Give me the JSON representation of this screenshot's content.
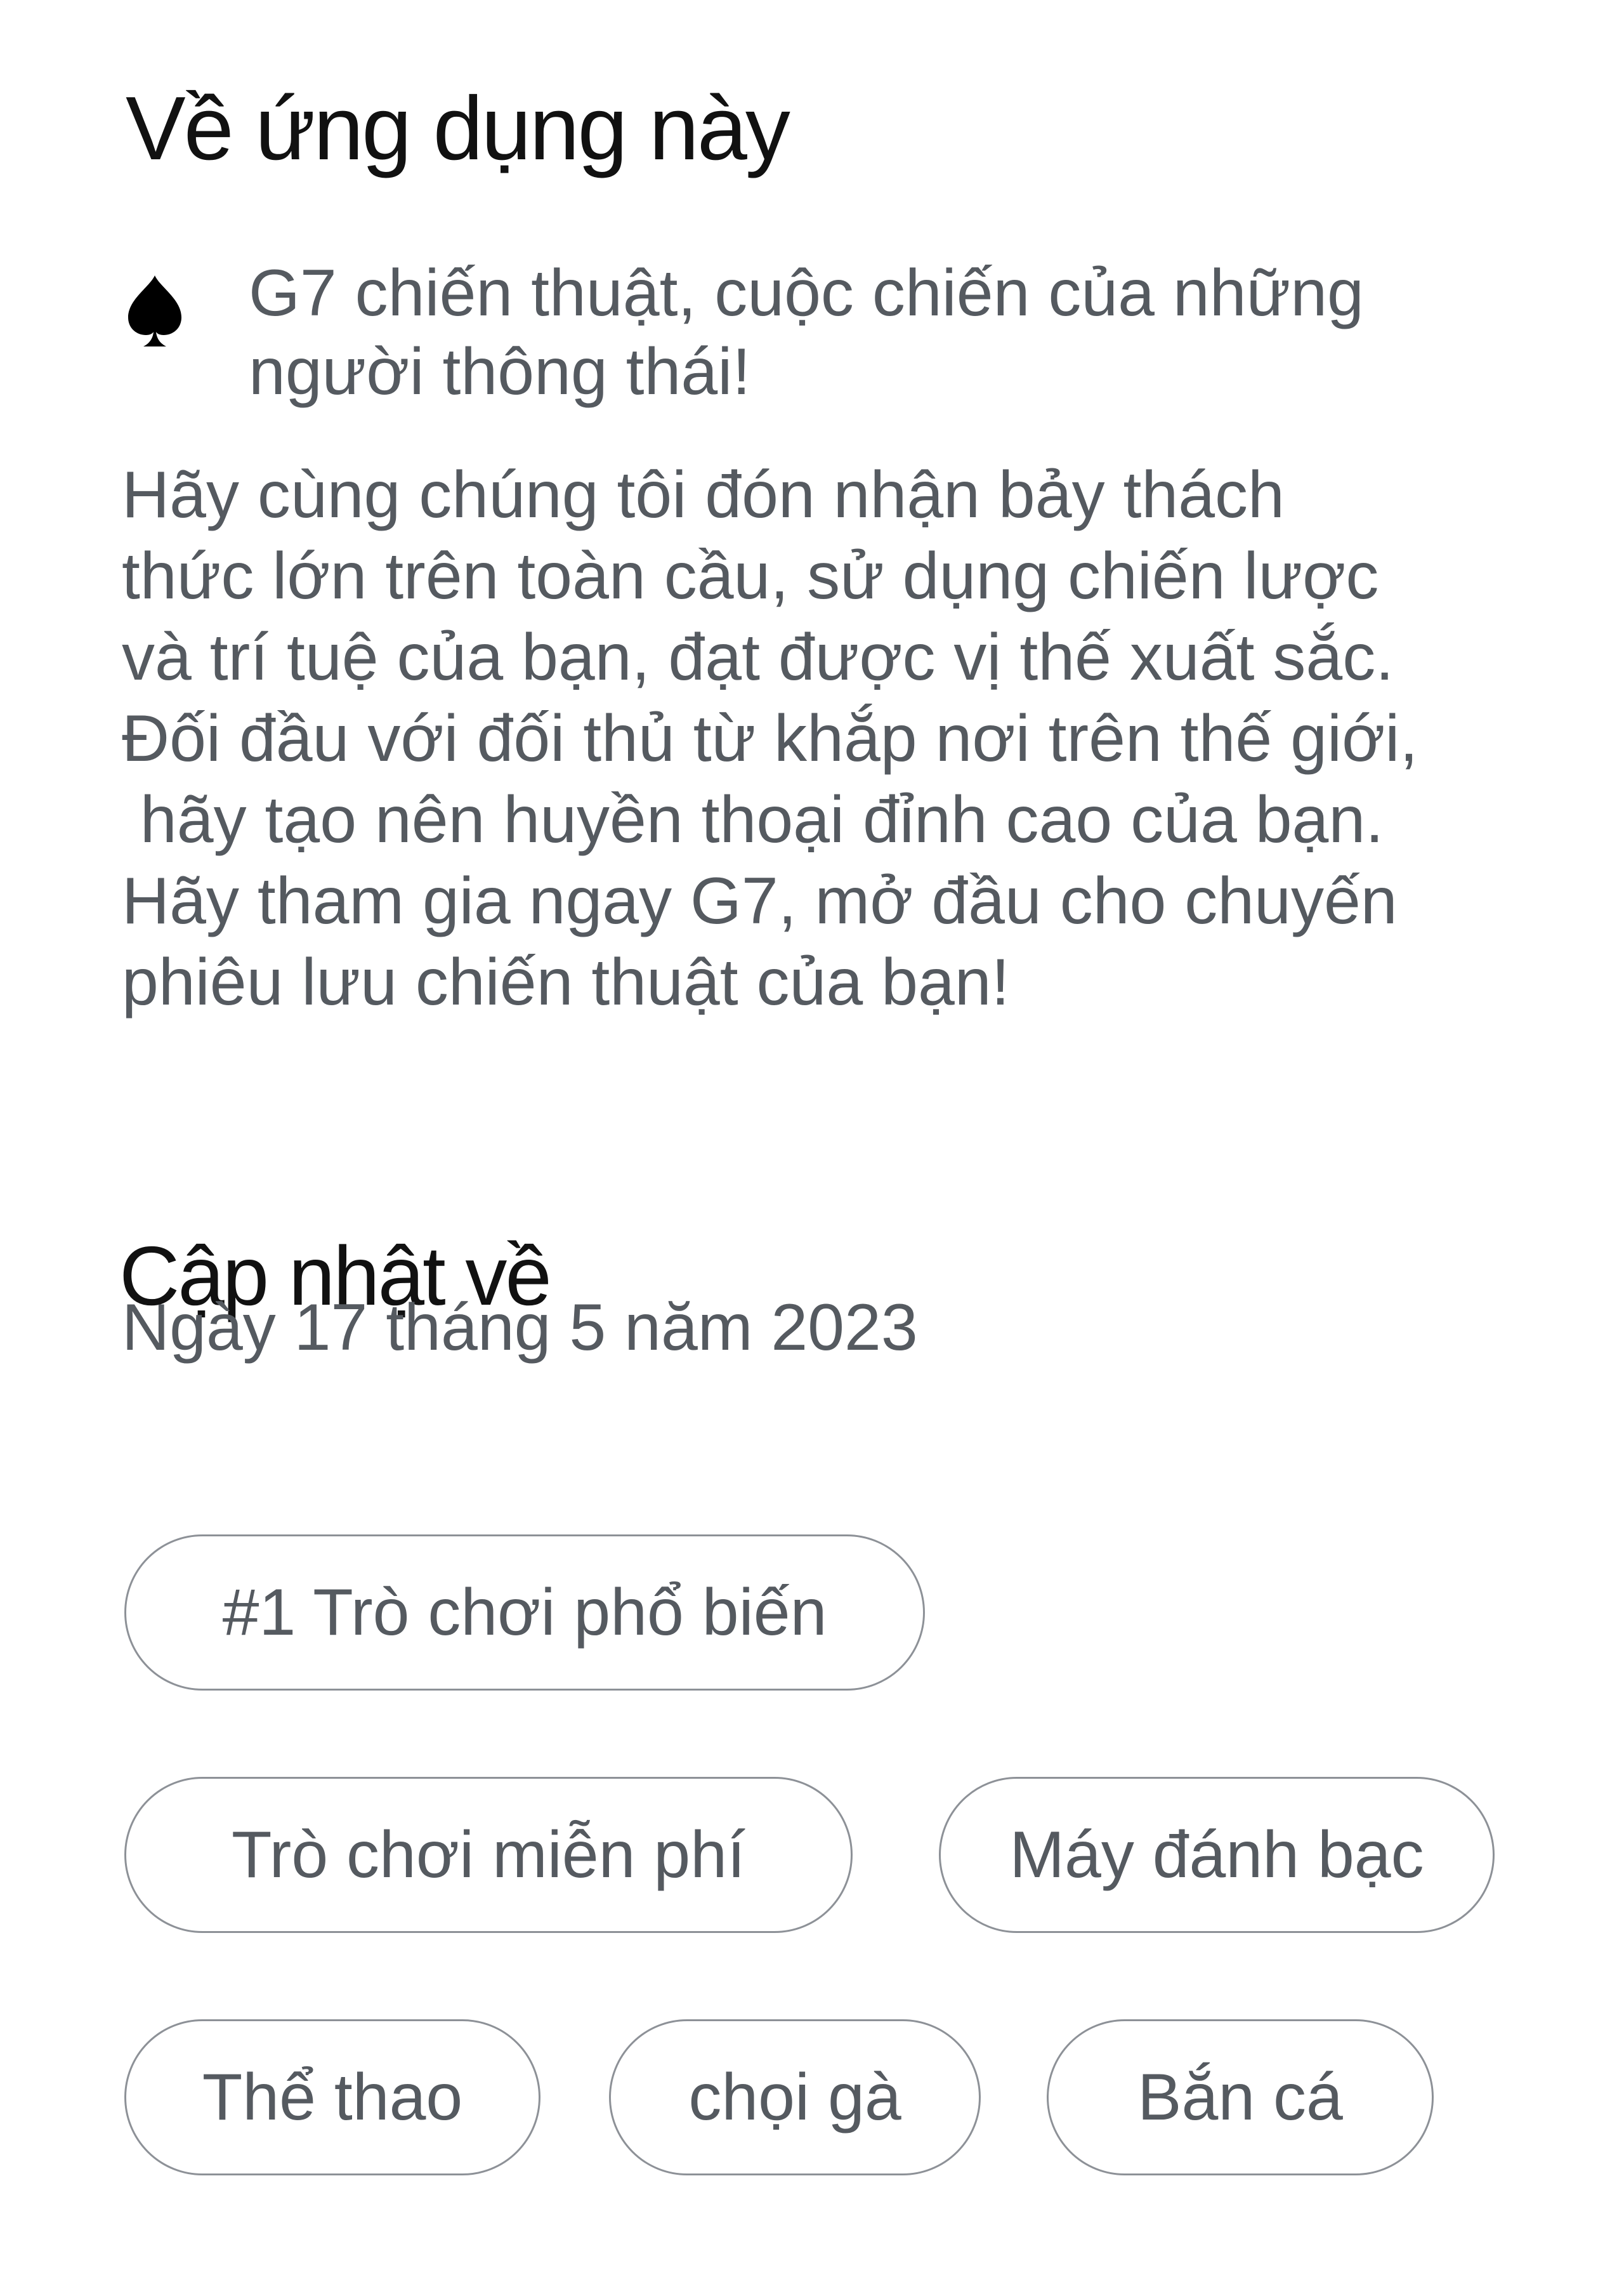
{
  "about": {
    "title": "Về ứng dụng này",
    "bullet_icon": "spade-icon",
    "tagline": "G7 chiến thuật, cuộc chiến của những người thông thái!",
    "description_lines": [
      "Hãy cùng chúng tôi đón nhận bảy thách",
      "thức lớn trên toàn cầu, sử dụng chiến lược",
      "và trí tuệ của bạn, đạt được vị thế xuất sắc.",
      "Đối đầu với đối thủ từ khắp nơi trên thế giới,",
      " hãy tạo nên huyền thoại đỉnh cao của bạn.",
      "Hãy tham gia ngay G7, mở đầu cho chuyến",
      "phiêu lưu chiến thuật của bạn!"
    ]
  },
  "update": {
    "title": "Cập nhật về",
    "date": "Ngày 17 tháng 5 năm 2023"
  },
  "tags": [
    "#1 Trò chơi phổ biến",
    "Trò chơi miễn phí",
    "Máy đánh bạc",
    "Thể thao",
    "chọi gà",
    "Bắn cá"
  ],
  "colors": {
    "heading": "#111111",
    "body_text": "#555a60",
    "chip_border": "#8d9197"
  }
}
